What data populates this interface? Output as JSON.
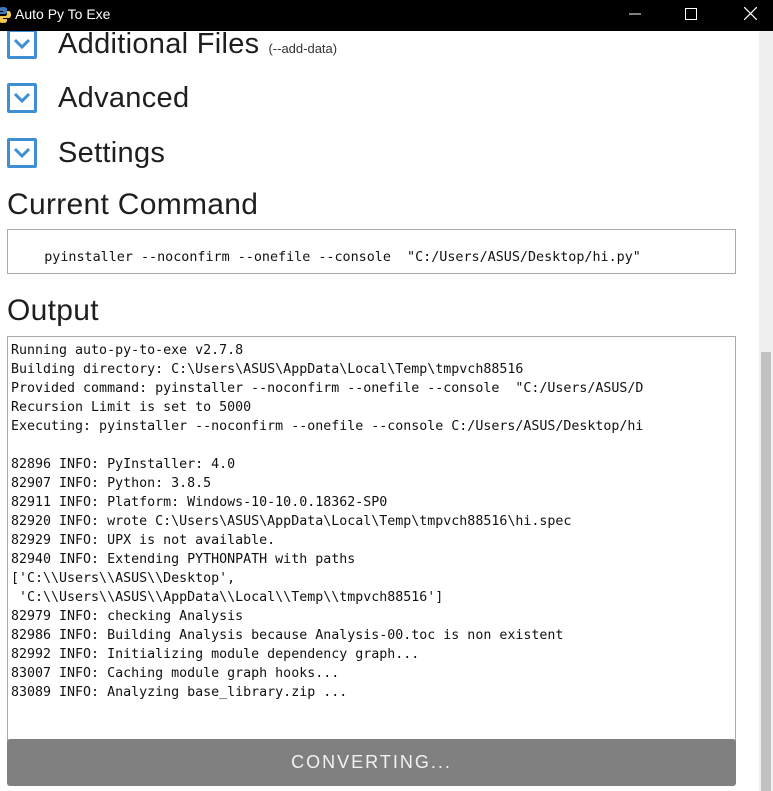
{
  "window": {
    "title": "Auto Py To Exe",
    "icon": "python-icon",
    "controls": [
      "minimize-icon",
      "maximize-icon",
      "close-icon"
    ]
  },
  "sections": [
    {
      "title": "Additional Files",
      "subtitle": "(--add-data)",
      "icon": "chevron-down-icon"
    },
    {
      "title": "Advanced",
      "subtitle": "",
      "icon": "chevron-down-icon"
    },
    {
      "title": "Settings",
      "subtitle": "",
      "icon": "chevron-down-icon"
    }
  ],
  "current_command": {
    "heading": "Current Command",
    "value": "pyinstaller --noconfirm --onefile --console  \"C:/Users/ASUS/Desktop/hi.py\""
  },
  "output": {
    "heading": "Output",
    "lines": [
      "Running auto-py-to-exe v2.7.8",
      "Building directory: C:\\Users\\ASUS\\AppData\\Local\\Temp\\tmpvch88516",
      "Provided command: pyinstaller --noconfirm --onefile --console  \"C:/Users/ASUS/D",
      "Recursion Limit is set to 5000",
      "Executing: pyinstaller --noconfirm --onefile --console C:/Users/ASUS/Desktop/hi",
      "",
      "82896 INFO: PyInstaller: 4.0",
      "82907 INFO: Python: 3.8.5",
      "82911 INFO: Platform: Windows-10-10.0.18362-SP0",
      "82920 INFO: wrote C:\\Users\\ASUS\\AppData\\Local\\Temp\\tmpvch88516\\hi.spec",
      "82929 INFO: UPX is not available.",
      "82940 INFO: Extending PYTHONPATH with paths",
      "['C:\\\\Users\\\\ASUS\\\\Desktop',",
      " 'C:\\\\Users\\\\ASUS\\\\AppData\\\\Local\\\\Temp\\\\tmpvch88516']",
      "82979 INFO: checking Analysis",
      "82986 INFO: Building Analysis because Analysis-00.toc is non existent",
      "82992 INFO: Initializing module dependency graph...",
      "83007 INFO: Caching module graph hooks...",
      "83089 INFO: Analyzing base_library.zip ..."
    ]
  },
  "convert_button": {
    "label": "CONVERTING..."
  },
  "colors": {
    "titlebar": "#000000",
    "accent": "#3f8fd2",
    "button_disabled": "#808080"
  }
}
